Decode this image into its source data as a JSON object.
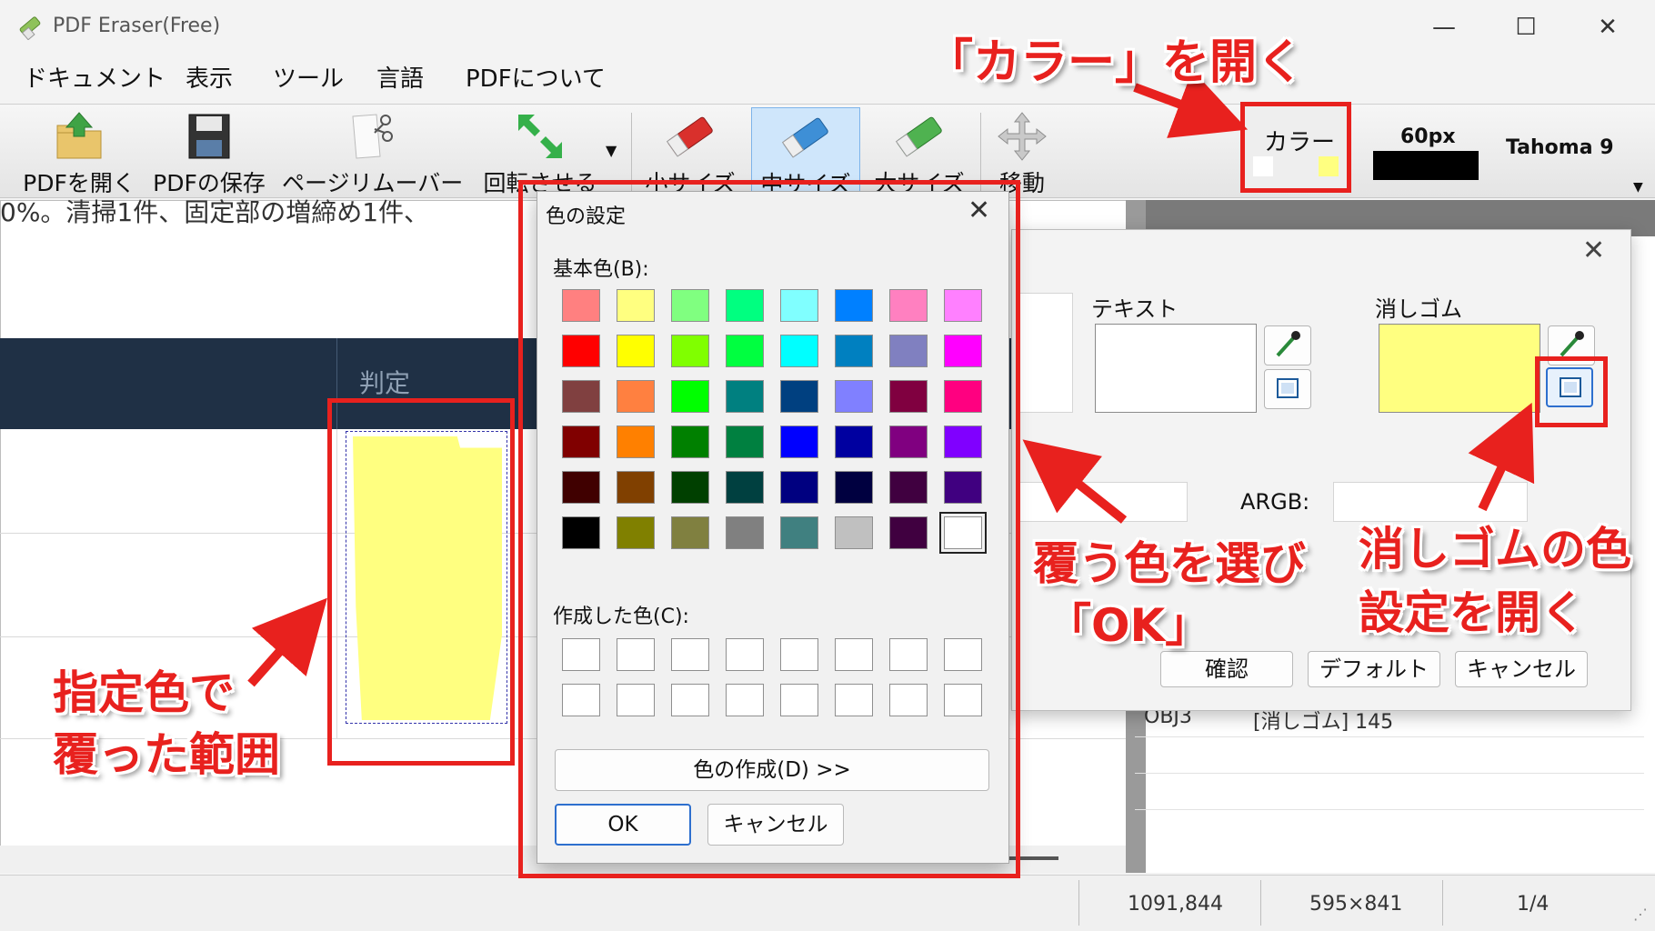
{
  "window": {
    "title": "PDF Eraser(Free)",
    "controls": {
      "minimize": "—",
      "maximize": "☐",
      "close": "✕"
    }
  },
  "menu": [
    "ドキュメント",
    "表示",
    "ツール",
    "言語",
    "PDFについて"
  ],
  "toolbar": {
    "buttons": [
      {
        "label": "PDFを開く",
        "icon": "folder-open-icon"
      },
      {
        "label": "PDFの保存",
        "icon": "save-disk-icon"
      },
      {
        "label": "ページリムーバー",
        "icon": "page-scissors-icon"
      },
      {
        "label": "回転させる",
        "icon": "rotate-arrows-icon"
      },
      {
        "label": "小サイズ",
        "icon": "eraser-red-icon"
      },
      {
        "label": "中サイズ",
        "icon": "eraser-blue-icon",
        "selected": true
      },
      {
        "label": "大サイズ",
        "icon": "eraser-green-icon"
      },
      {
        "label": "移動",
        "icon": "move-cross-icon"
      }
    ],
    "color_label": "カラー",
    "text_color": "#ffffff",
    "eraser_color": "#ffff80",
    "size_label": "60px",
    "font_label": "Tahoma 9"
  },
  "document": {
    "top_text": "0%。清掃1件、固定部の増締め1件、",
    "header_label": "判定"
  },
  "right_panel": {
    "obj_id": "OBJ3",
    "obj_name": "[消しゴム] 145"
  },
  "color_settings": {
    "text_label": "テキスト",
    "eraser_label": "消しゴム",
    "argb_label": "ARGB:",
    "confirm": "確認",
    "default": "デフォルト",
    "cancel": "キャンセル",
    "close": "✕"
  },
  "color_dialog": {
    "title": "色の設定",
    "close": "✕",
    "basic_label": "基本色(B):",
    "custom_label": "作成した色(C):",
    "define_button": "色の作成(D) >>",
    "ok": "OK",
    "cancel": "キャンセル",
    "basic_colors": [
      [
        "#ff8080",
        "#ffff80",
        "#80ff80",
        "#00ff80",
        "#80ffff",
        "#0080ff",
        "#ff80c0",
        "#ff80ff"
      ],
      [
        "#ff0000",
        "#ffff00",
        "#80ff00",
        "#00ff40",
        "#00ffff",
        "#0080c0",
        "#8080c0",
        "#ff00ff"
      ],
      [
        "#804040",
        "#ff8040",
        "#00ff00",
        "#008080",
        "#004080",
        "#8080ff",
        "#800040",
        "#ff0080"
      ],
      [
        "#800000",
        "#ff8000",
        "#008000",
        "#008040",
        "#0000ff",
        "#0000a0",
        "#800080",
        "#8000ff"
      ],
      [
        "#400000",
        "#804000",
        "#004000",
        "#004040",
        "#000080",
        "#000040",
        "#400040",
        "#400080"
      ],
      [
        "#000000",
        "#808000",
        "#808040",
        "#808080",
        "#408080",
        "#c0c0c0",
        "#400040",
        "#ffffff"
      ]
    ],
    "selected_index": [
      5,
      7
    ]
  },
  "status": {
    "coords": "1091,844",
    "page_size": "595×841",
    "page": "1/4"
  },
  "annotations": {
    "open_color": "「カラー」を開く",
    "covered_line1": "指定色で",
    "covered_line2": "覆った範囲",
    "choose_line1": "覆う色を選び",
    "choose_line2": "「OK」",
    "eraser_line1": "消しゴムの色",
    "eraser_line2": "設定を開く"
  }
}
